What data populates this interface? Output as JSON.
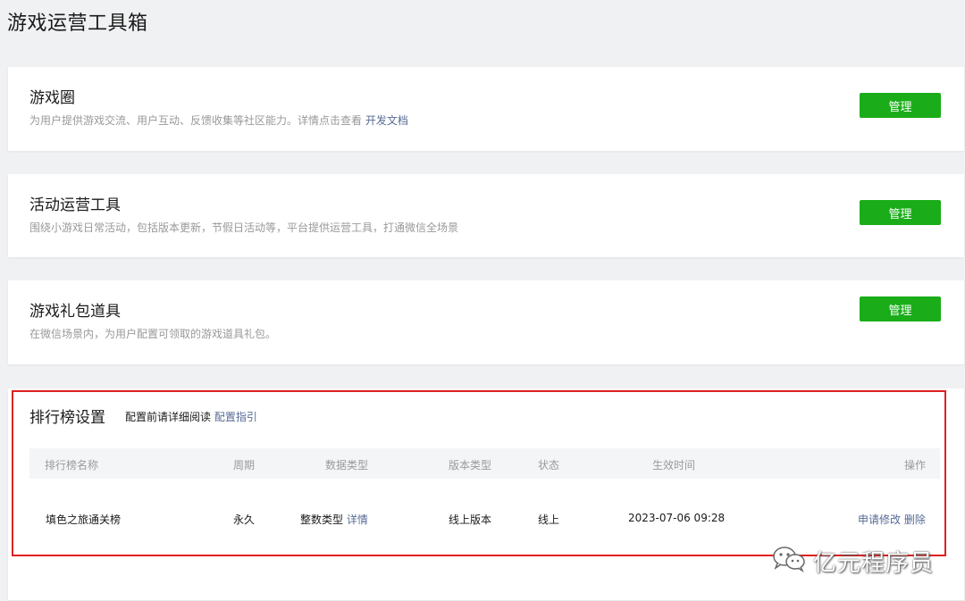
{
  "page": {
    "title": "游戏运营工具箱"
  },
  "cards": [
    {
      "title": "游戏圈",
      "desc": "为用户提供游戏交流、用户互动、反馈收集等社区能力。详情点击查看 ",
      "link": "开发文档",
      "button": "管理"
    },
    {
      "title": "活动运营工具",
      "desc": "围绕小游戏日常活动，包括版本更新，节假日活动等，平台提供运营工具，打通微信全场景",
      "button": "管理"
    },
    {
      "title": "游戏礼包道具",
      "desc": "在微信场景内，为用户配置可领取的游戏道具礼包。",
      "button": "管理"
    }
  ],
  "ranking": {
    "title": "排行榜设置",
    "hint": "配置前请详细阅读 ",
    "hint_link": "配置指引",
    "columns": [
      "排行榜名称",
      "周期",
      "数据类型",
      "版本类型",
      "状态",
      "生效时间",
      "操作"
    ],
    "row": {
      "name": "填色之旅通关榜",
      "period": "永久",
      "data_type": "整数类型",
      "data_type_link": "详情",
      "version": "线上版本",
      "status": "线上",
      "effective_time": "2023-07-06 09:28",
      "action_edit": "申请修改",
      "action_delete": "删除"
    }
  },
  "watermark": {
    "text": "亿元程序员",
    "icon": "wechat-icon"
  },
  "colors": {
    "primary_button": "#1aad19",
    "link": "#576b95",
    "highlight_border": "#e02020",
    "background": "#f0f1f3"
  }
}
